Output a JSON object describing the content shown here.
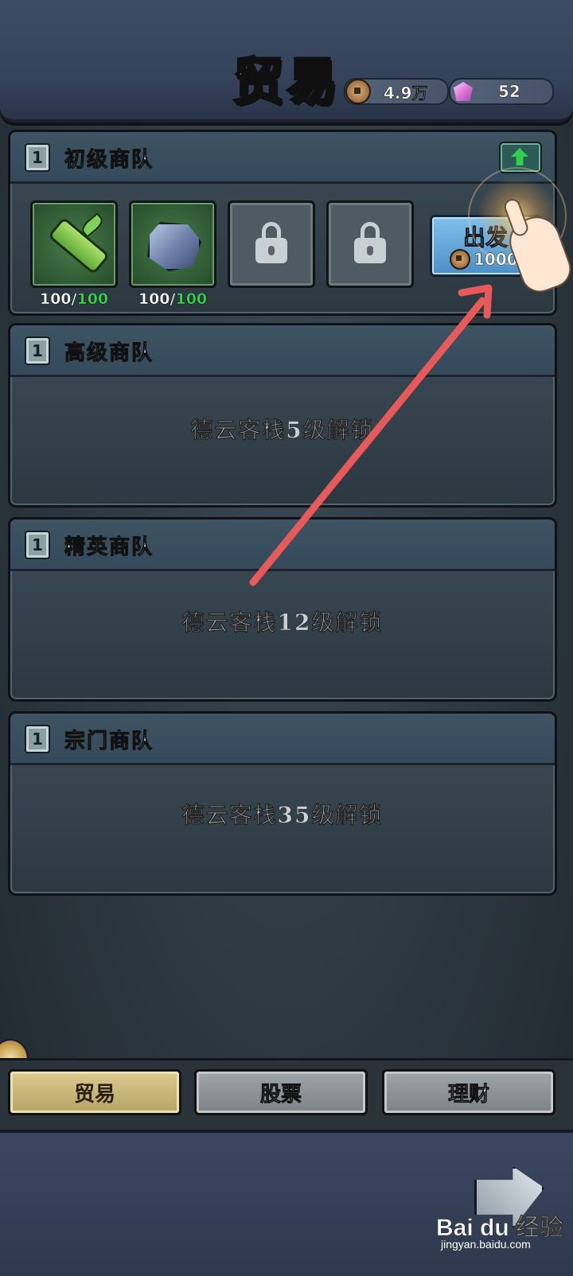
{
  "header": {
    "title": "贸易",
    "coins": "4.9万",
    "gems": "52"
  },
  "caravans": [
    {
      "level": "1",
      "name": "初级商队",
      "slots": [
        {
          "icon": "bamboo-icon",
          "count": "100",
          "max": "100"
        },
        {
          "icon": "ore-icon",
          "count": "100",
          "max": "100"
        },
        {
          "icon": "lock-icon"
        },
        {
          "icon": "lock-icon"
        }
      ],
      "depart_label": "出发",
      "depart_cost": "1000"
    },
    {
      "level": "1",
      "name": "高级商队",
      "unlock": "德云客栈5级解锁"
    },
    {
      "level": "1",
      "name": "精英商队",
      "unlock": "德云客栈12级解锁"
    },
    {
      "level": "1",
      "name": "宗门商队",
      "unlock": "德云客栈35级解锁"
    }
  ],
  "tabs": [
    {
      "label": "贸易",
      "active": true
    },
    {
      "label": "股票",
      "active": false
    },
    {
      "label": "理财",
      "active": false
    }
  ],
  "watermark": {
    "brand": "Bai du 经验",
    "url": "jingyan.baidu.com"
  },
  "colors": {
    "accent_green": "#35d64a",
    "depart_blue": "#4d8fc6",
    "annotation_red": "#e85a5a",
    "tab_active": "#dbc98e"
  }
}
